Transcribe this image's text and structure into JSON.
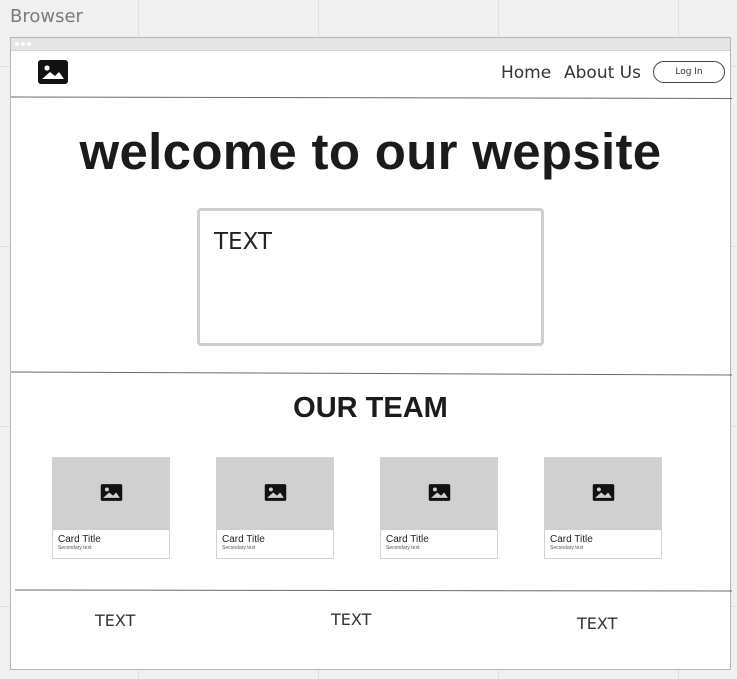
{
  "canvas": {
    "label": "Browser"
  },
  "nav": {
    "items": [
      "Home",
      "About Us"
    ],
    "login_label": "Log In"
  },
  "hero": {
    "title": "welcome to our wepsite",
    "text_box_label": "TEXT"
  },
  "team": {
    "title": "OUR TEAM",
    "cards": [
      {
        "title": "Card Title",
        "secondary": "Secondary text"
      },
      {
        "title": "Card Title",
        "secondary": "Secondary text"
      },
      {
        "title": "Card Title",
        "secondary": "Secondary text"
      },
      {
        "title": "Card Title",
        "secondary": "Secondary text"
      }
    ]
  },
  "footer": {
    "texts": [
      "TEXT",
      "TEXT",
      "TEXT"
    ]
  },
  "icons": {
    "logo": "image-placeholder-icon",
    "card_image": "image-placeholder-icon"
  }
}
